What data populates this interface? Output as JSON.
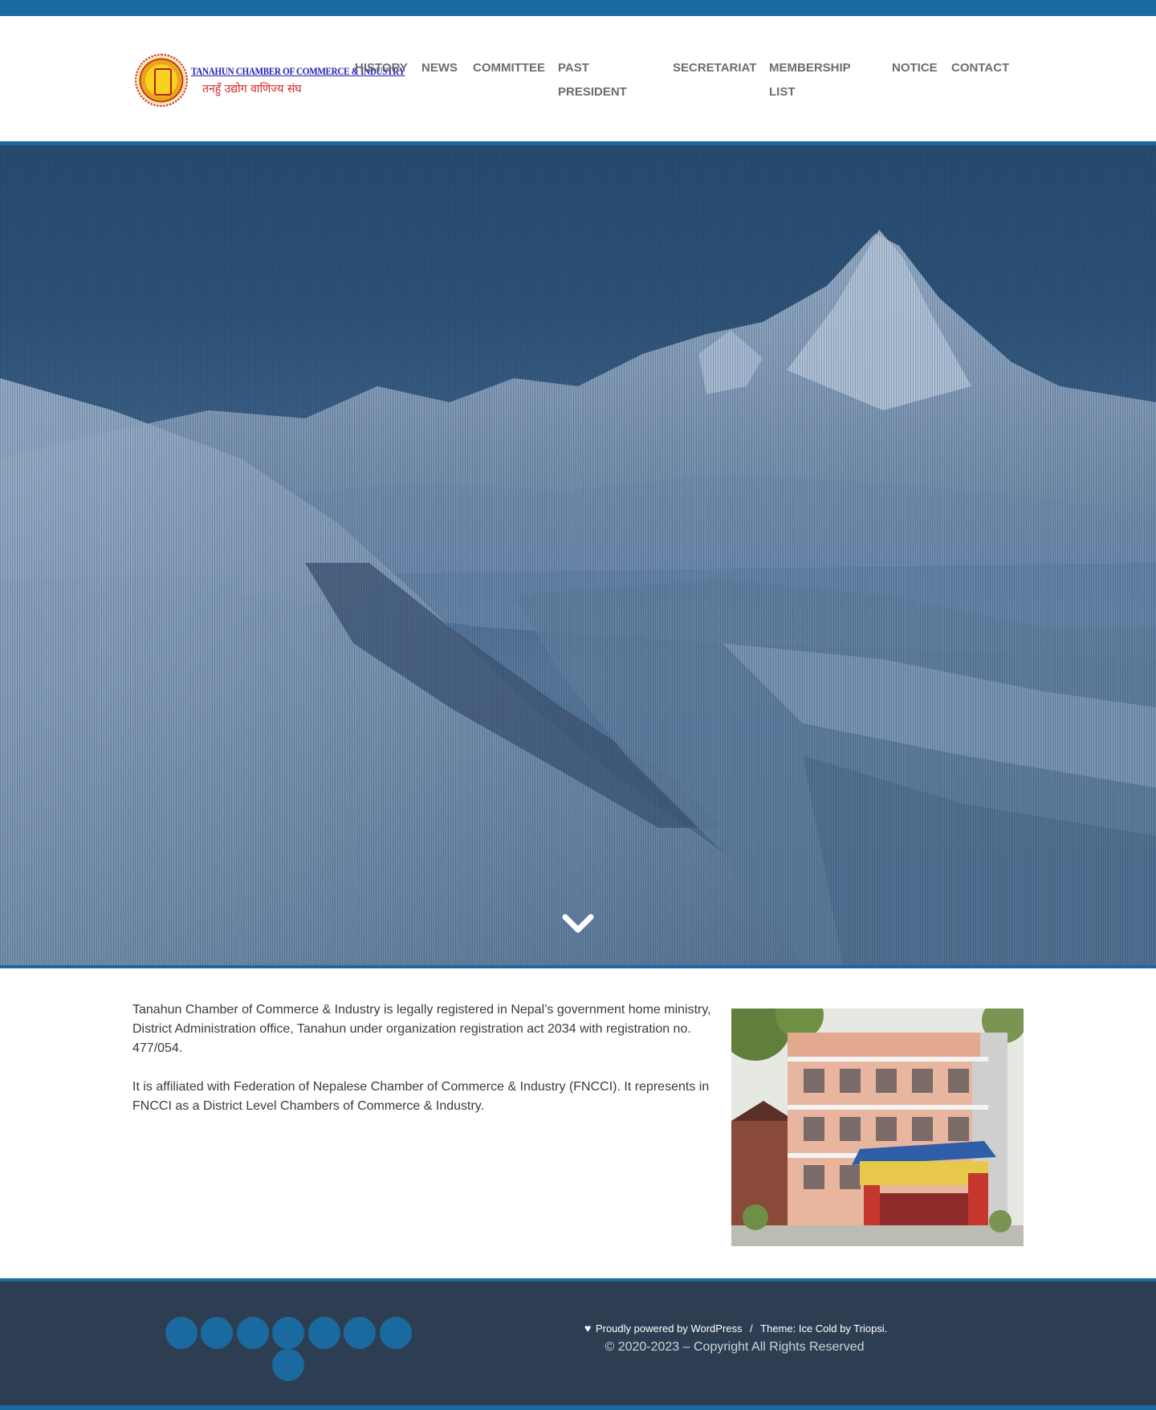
{
  "logo": {
    "title_en": "TANAHUN CHAMBER OF COMMERCE & INDUSTRY",
    "title_np": "तनहुँ उद्योग वाणिज्य संघ"
  },
  "nav": {
    "items": [
      {
        "label": "History"
      },
      {
        "label": "News"
      },
      {
        "label": "Committee"
      },
      {
        "label": "Past"
      },
      {
        "label": "President"
      },
      {
        "label": "Secretariat"
      },
      {
        "label": "Membership"
      },
      {
        "label": "List"
      },
      {
        "label": "Notice"
      },
      {
        "label": "Contact"
      }
    ]
  },
  "hero": {
    "scroll_icon": "chevron-down-icon"
  },
  "about": {
    "paragraph_1": "Tanahun Chamber of Commerce & Industry is legally registered in Nepal’s government home ministry, District Administration office, Tanahun under organization registration act 2034 with registration no. 477/054.",
    "paragraph_2": "It is affiliated with Federation of Nepalese Chamber of Commerce & Industry (FNCCI). It represents in FNCCI as a District Level Chambers of Commerce & Industry."
  },
  "footer": {
    "social_count": 8,
    "powered_by": "Proudly powered by WordPress",
    "separator": "/",
    "theme_label": "Theme: Ice Cold by Triopsi.",
    "copyright": "© 2020-2023 – Copyright All Rights Reserved",
    "heart_icon": "heart-icon"
  },
  "colors": {
    "accent": "#1a6aa0",
    "footer_bg": "#2e3e52",
    "nav_text": "#6d6d6d"
  }
}
